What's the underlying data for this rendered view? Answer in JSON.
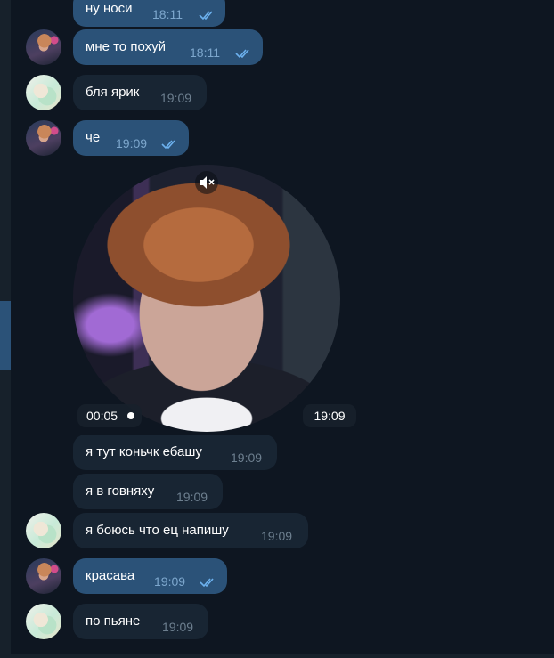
{
  "messages": [
    {
      "text": "ну носи",
      "time": "18:11",
      "direction": "out",
      "read": true
    },
    {
      "text": "мне то похуй",
      "time": "18:11",
      "direction": "out",
      "read": true
    },
    {
      "text": "бля ярик",
      "time": "19:09",
      "direction": "in"
    },
    {
      "text": "че",
      "time": "19:09",
      "direction": "out",
      "read": true
    },
    {
      "text": "я тут коньчк ебашу",
      "time": "19:09",
      "direction": "in"
    },
    {
      "text": "я в говняху",
      "time": "19:09",
      "direction": "in"
    },
    {
      "text": "я боюсь что ец напишу",
      "time": "19:09",
      "direction": "in"
    },
    {
      "text": "красава",
      "time": "19:09",
      "direction": "out",
      "read": true
    },
    {
      "text": "по пьяне",
      "time": "19:09",
      "direction": "in"
    }
  ],
  "video_message": {
    "duration": "00:05",
    "time": "19:09",
    "muted": true,
    "icon": "speaker-muted-icon"
  },
  "colors": {
    "background": "#0e1621",
    "outgoing_bubble": "#2b5278",
    "incoming_bubble": "#182533",
    "read_check": "#6cb1ee",
    "time_out": "#7da7cd",
    "time_in": "#6d7f8f"
  },
  "icons": {
    "read_receipt": "double-check-icon",
    "avatar_me": "avatar",
    "avatar_other": "avatar"
  }
}
